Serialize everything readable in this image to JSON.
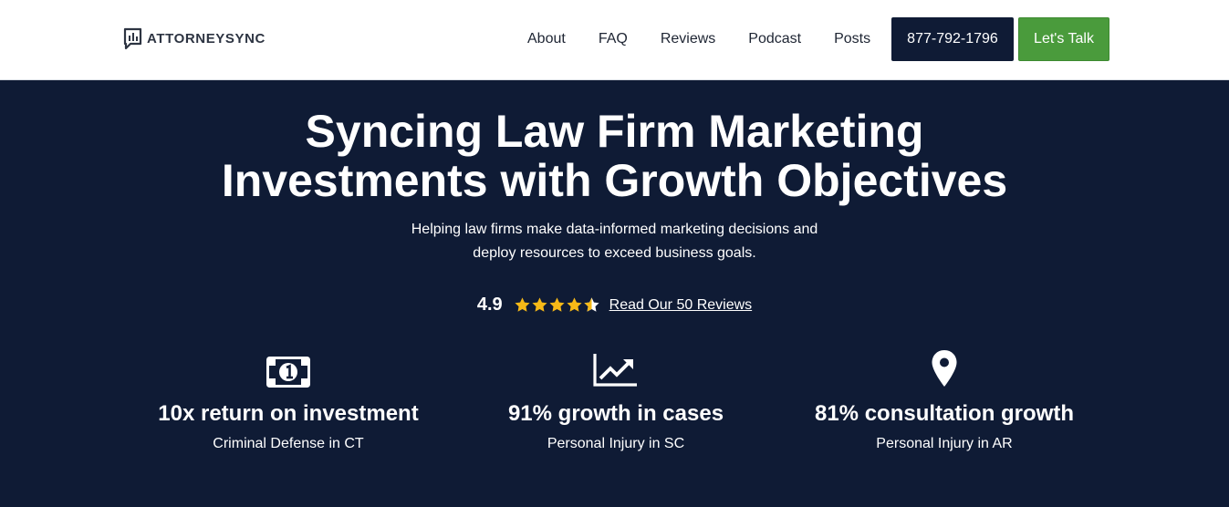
{
  "header": {
    "logo_text": "ATTORNEYSYNC",
    "nav": [
      "About",
      "FAQ",
      "Reviews",
      "Podcast",
      "Posts"
    ],
    "phone": "877-792-1796",
    "cta": "Let's Talk"
  },
  "hero": {
    "title_line1": "Syncing Law Firm Marketing",
    "title_line2": "Investments with Growth Objectives",
    "subtitle_line1": "Helping law firms make data-informed marketing decisions and",
    "subtitle_line2": "deploy resources to exceed business goals.",
    "rating": "4.9",
    "rating_stars": 4.5,
    "reviews_link": "Read Our 50 Reviews",
    "star_color": "#f6b917"
  },
  "stats": [
    {
      "icon": "money-bill-icon",
      "title": "10x return on investment",
      "sub": "Criminal Defense in CT"
    },
    {
      "icon": "chart-line-icon",
      "title": "91% growth in cases",
      "sub": "Personal Injury in SC"
    },
    {
      "icon": "map-pin-icon",
      "title": "81% consultation growth",
      "sub": "Personal Injury in AR"
    }
  ],
  "colors": {
    "navy": "#0f1b35",
    "green": "#4a9b3c"
  }
}
